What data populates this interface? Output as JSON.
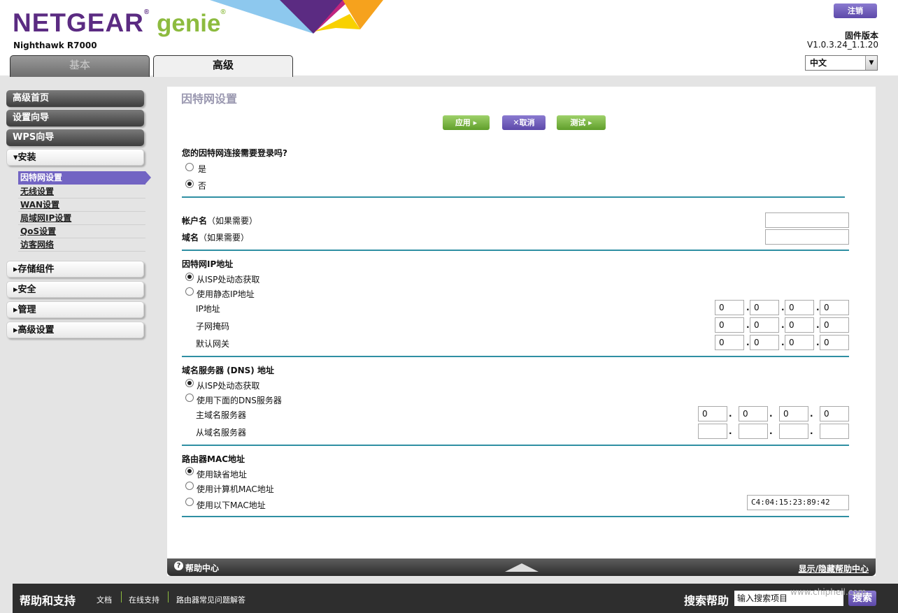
{
  "brand": {
    "logo_main": "NETGEAR",
    "logo_reg": "®",
    "logo_genie": " genie",
    "logo_genie_reg": "®",
    "model": "Nighthawk R7000"
  },
  "header": {
    "logout_label": "注销",
    "firmware_label": "固件版本",
    "firmware_version": "V1.0.3.24_1.1.20",
    "language": "中文"
  },
  "tabs": {
    "basic": "基本",
    "advanced": "高级"
  },
  "sidebar": {
    "top_buttons": [
      "高级首页",
      "设置向导",
      "WPS向导"
    ],
    "install": {
      "label": "▾安装",
      "items": [
        "因特网设置",
        "无线设置",
        "WAN设置",
        "局域网IP设置",
        "QoS设置",
        "访客网络"
      ]
    },
    "sections": [
      "▸存储组件",
      "▸安全",
      "▸管理",
      "▸高级设置"
    ]
  },
  "page": {
    "title": "因特网设置",
    "buttons": {
      "apply": "应用 ▸",
      "cancel": "✕取消",
      "test": "测试 ▸"
    },
    "login_question": "您的因特网连接需要登录吗?",
    "login_options": [
      "是",
      "否"
    ],
    "account_name": "帐户名",
    "domain_name": "域名",
    "if_needed": "（如果需要）",
    "inet_ip": {
      "title": "因特网IP地址",
      "options": [
        "从ISP处动态获取",
        "使用静态IP地址"
      ],
      "fields": [
        {
          "label": "IP地址",
          "octets": [
            "0",
            "0",
            "0",
            "0"
          ]
        },
        {
          "label": "子网掩码",
          "octets": [
            "0",
            "0",
            "0",
            "0"
          ]
        },
        {
          "label": "默认网关",
          "octets": [
            "0",
            "0",
            "0",
            "0"
          ]
        }
      ]
    },
    "dns": {
      "title": "域名服务器 (DNS) 地址",
      "options": [
        "从ISP处动态获取",
        "使用下面的DNS服务器"
      ],
      "primary": {
        "label": "主域名服务器",
        "octets": [
          "0",
          "0",
          "0",
          "0"
        ]
      },
      "secondary": {
        "label": "从域名服务器",
        "octets": [
          "",
          "",
          "",
          ""
        ]
      }
    },
    "mac": {
      "title": "路由器MAC地址",
      "options": [
        "使用缺省地址",
        "使用计算机MAC地址",
        "使用以下MAC地址"
      ],
      "value": "C4:04:15:23:89:42"
    }
  },
  "help_bar": {
    "title": "帮助中心",
    "icon": "?",
    "toggle": "显示/隐藏帮助中心"
  },
  "footer": {
    "title": "帮助和支持",
    "links": [
      "文档",
      "在线支持",
      "路由器常见问题解答"
    ],
    "search_title": "搜索帮助",
    "search_placeholder": "输入搜索项目",
    "search_button": "搜索"
  },
  "watermark": "www.chiphell.com",
  "colors": {
    "purple": "#5b2b82",
    "green": "#8dbb3f",
    "accent_line": "#2f8fa3",
    "active_nav": "#7264c3"
  }
}
